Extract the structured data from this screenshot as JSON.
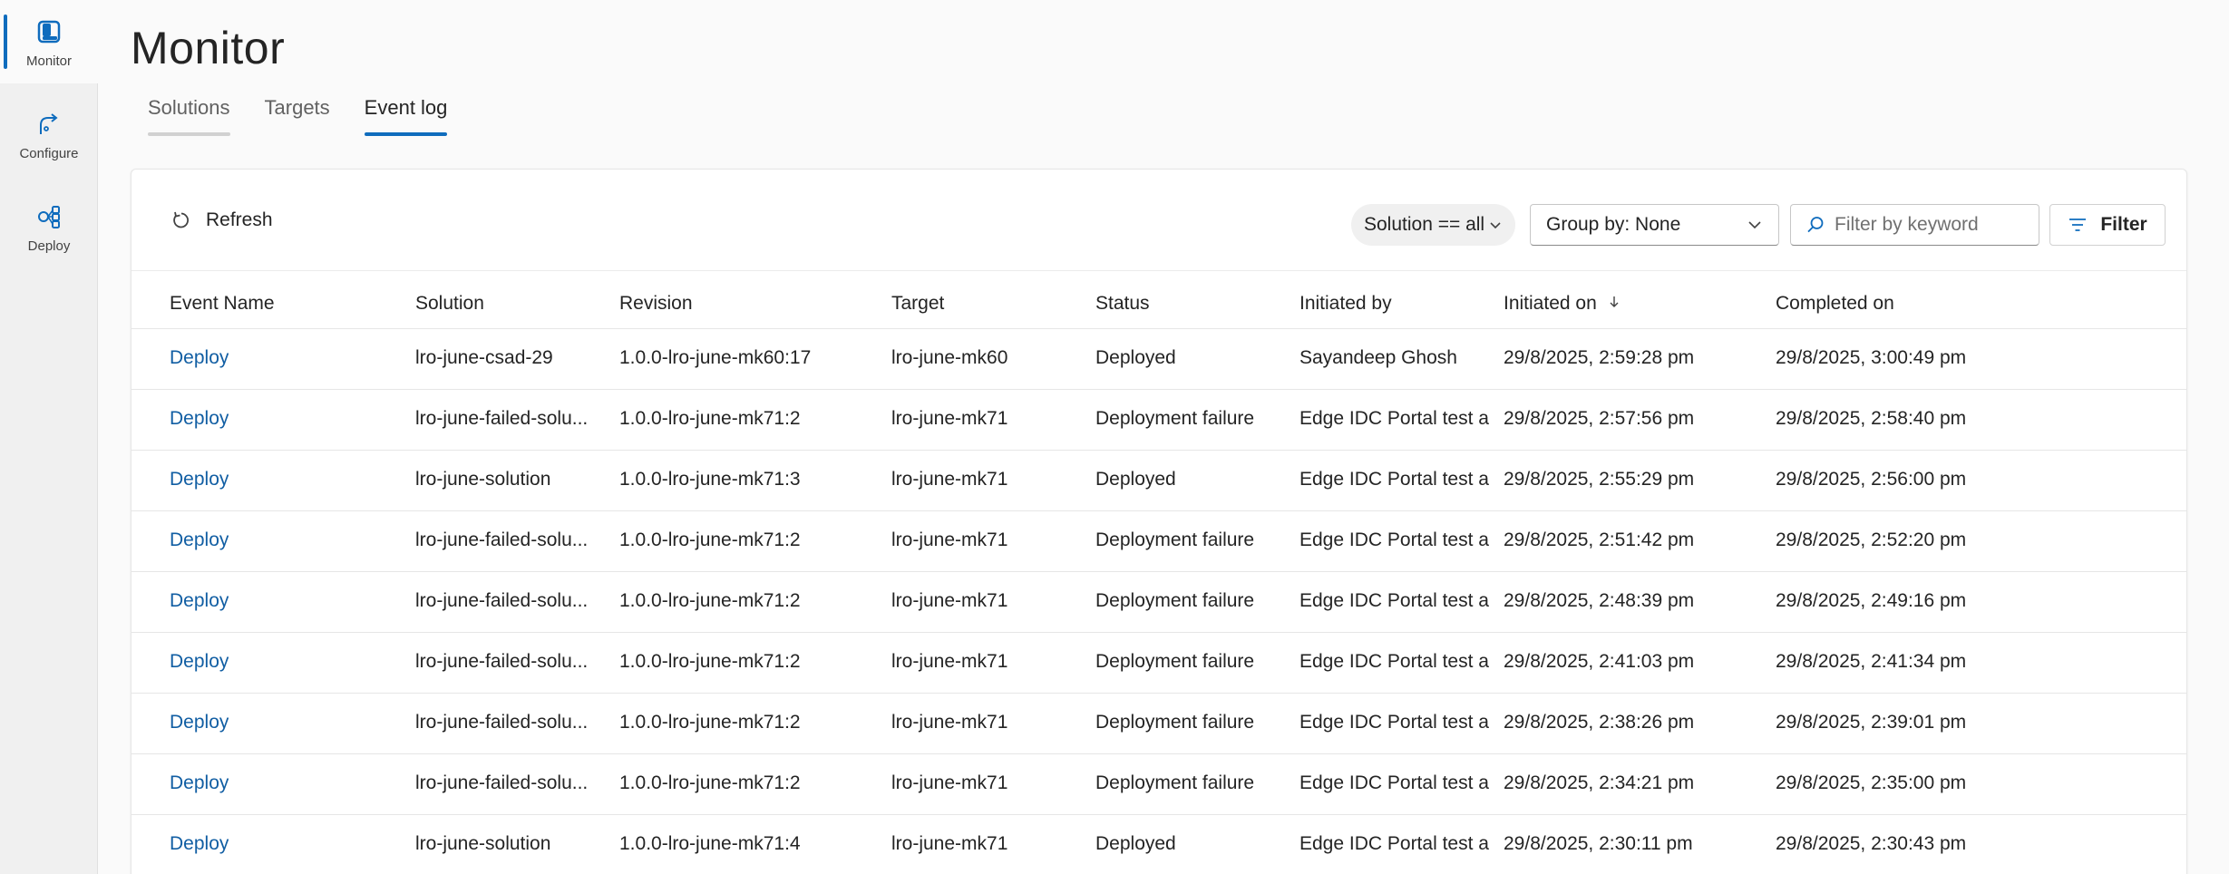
{
  "nav": {
    "items": [
      {
        "label": "Monitor",
        "icon": "monitor-icon",
        "active": true
      },
      {
        "label": "Configure",
        "icon": "configure-icon",
        "active": false
      },
      {
        "label": "Deploy",
        "icon": "deploy-icon",
        "active": false
      }
    ]
  },
  "page": {
    "title": "Monitor",
    "tabs": [
      {
        "label": "Solutions"
      },
      {
        "label": "Targets"
      },
      {
        "label": "Event log"
      }
    ]
  },
  "toolbar": {
    "refresh_label": "Refresh",
    "solution_filter": "Solution == all",
    "group_by": "Group by: None",
    "search_placeholder": "Filter by keyword",
    "filter_label": "Filter"
  },
  "table": {
    "columns": [
      "Event Name",
      "Solution",
      "Revision",
      "Target",
      "Status",
      "Initiated by",
      "Initiated on",
      "Completed on"
    ],
    "rows": [
      [
        "Deploy",
        "lro-june-csad-29",
        "1.0.0-lro-june-mk60:17",
        "lro-june-mk60",
        "Deployed",
        "Sayandeep Ghosh",
        "29/8/2025, 2:59:28 pm",
        "29/8/2025, 3:00:49 pm"
      ],
      [
        "Deploy",
        "lro-june-failed-solu...",
        "1.0.0-lro-june-mk71:2",
        "lro-june-mk71",
        "Deployment failure",
        "Edge IDC Portal test a",
        "29/8/2025, 2:57:56 pm",
        "29/8/2025, 2:58:40 pm"
      ],
      [
        "Deploy",
        "lro-june-solution",
        "1.0.0-lro-june-mk71:3",
        "lro-june-mk71",
        "Deployed",
        "Edge IDC Portal test a",
        "29/8/2025, 2:55:29 pm",
        "29/8/2025, 2:56:00 pm"
      ],
      [
        "Deploy",
        "lro-june-failed-solu...",
        "1.0.0-lro-june-mk71:2",
        "lro-june-mk71",
        "Deployment failure",
        "Edge IDC Portal test a",
        "29/8/2025, 2:51:42 pm",
        "29/8/2025, 2:52:20 pm"
      ],
      [
        "Deploy",
        "lro-june-failed-solu...",
        "1.0.0-lro-june-mk71:2",
        "lro-june-mk71",
        "Deployment failure",
        "Edge IDC Portal test a",
        "29/8/2025, 2:48:39 pm",
        "29/8/2025, 2:49:16 pm"
      ],
      [
        "Deploy",
        "lro-june-failed-solu...",
        "1.0.0-lro-june-mk71:2",
        "lro-june-mk71",
        "Deployment failure",
        "Edge IDC Portal test a",
        "29/8/2025, 2:41:03 pm",
        "29/8/2025, 2:41:34 pm"
      ],
      [
        "Deploy",
        "lro-june-failed-solu...",
        "1.0.0-lro-june-mk71:2",
        "lro-june-mk71",
        "Deployment failure",
        "Edge IDC Portal test a",
        "29/8/2025, 2:38:26 pm",
        "29/8/2025, 2:39:01 pm"
      ],
      [
        "Deploy",
        "lro-june-failed-solu...",
        "1.0.0-lro-june-mk71:2",
        "lro-june-mk71",
        "Deployment failure",
        "Edge IDC Portal test a",
        "29/8/2025, 2:34:21 pm",
        "29/8/2025, 2:35:00 pm"
      ],
      [
        "Deploy",
        "lro-june-solution",
        "1.0.0-lro-june-mk71:4",
        "lro-june-mk71",
        "Deployed",
        "Edge IDC Portal test a",
        "29/8/2025, 2:30:11 pm",
        "29/8/2025, 2:30:43 pm"
      ]
    ]
  },
  "colors": {
    "accent": "#0f6cbd",
    "link": "#115ea3"
  }
}
